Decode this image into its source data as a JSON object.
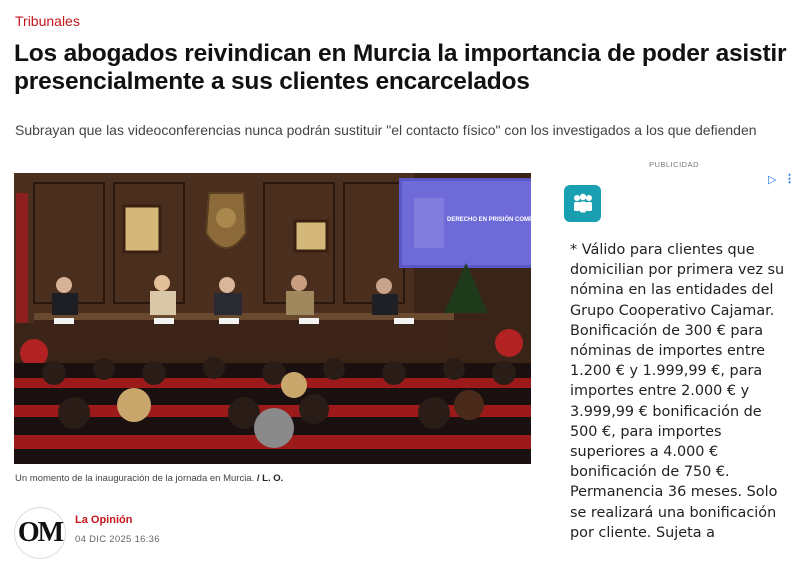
{
  "article": {
    "section": "Tribunales",
    "headline": "Los abogados reivindican en Murcia la importancia de poder asistir presencialmente a sus clientes encarcelados",
    "subtitle": "Subrayan que las videoconferencias nunca podrán sustituir \"el contacto físico\" con los investigados a los que defienden",
    "photo": {
      "screen_title": "DERECHO EN PRISIÓN COMPROMISO Y ACC",
      "caption": "Un momento de la inauguración de la jornada en Murcia.",
      "credit": "/ L. O."
    },
    "byline": {
      "logo_text": "OM",
      "author": "La Opinión",
      "date": "04 DIC 2025 16:36"
    }
  },
  "ad": {
    "label": "PUBLICIDAD",
    "choices_icon": "adchoices-icon",
    "menu_icon": "kebab-menu-icon",
    "brand_icon": "people-group-icon",
    "brand_color": "#1a9fb0",
    "body": "* Válido para clientes que domicilian por primera vez su nómina en las entidades del Grupo Cooperativo Cajamar. Bonificación de 300 € para nóminas de importes entre 1.200 € y 1.999,99 €, para importes entre 2.000 € y 3.999,99 € bonificación de 500 €, para importes superiores a 4.000 € bonificación de 750 €. Permanencia 36 meses. Solo se realizará una bonificación por cliente. Sujeta a"
  },
  "colors": {
    "accent": "#c4161c",
    "link": "#1a73e8"
  }
}
